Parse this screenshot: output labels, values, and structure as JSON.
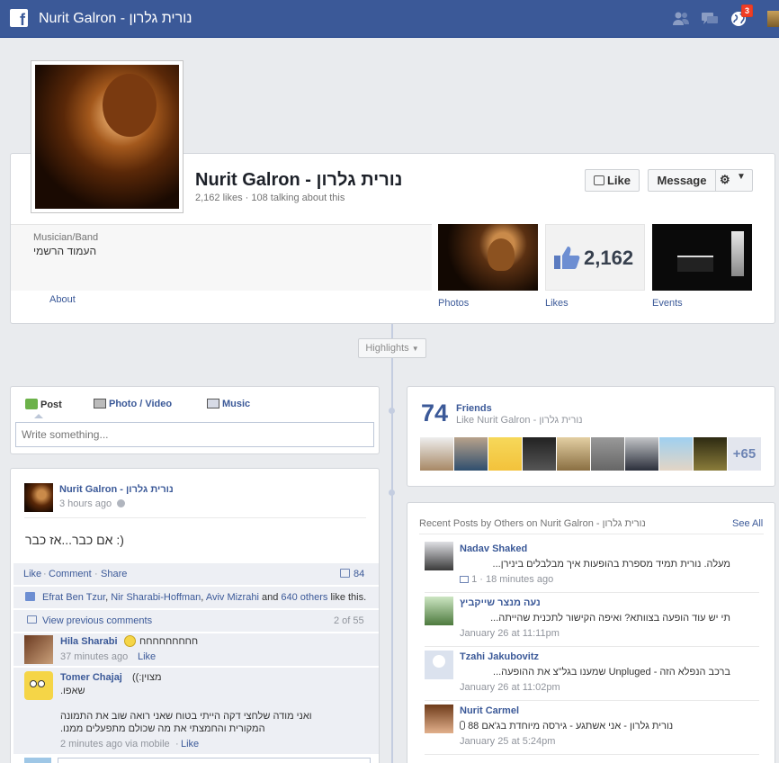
{
  "topbar": {
    "title": "Nurit Galron - נורית גלרון",
    "notifications_count": "3",
    "logo": "f"
  },
  "page": {
    "name": "Nurit Galron - נורית גלרון",
    "stats": "2,162 likes · 108 talking about this",
    "category": "Musician/Band",
    "description": "העמוד הרשמי",
    "about_label": "About",
    "like_button": "Like",
    "message_button": "Message"
  },
  "apps": {
    "photos_label": "Photos",
    "likes_label": "Likes",
    "likes_count": "2,162",
    "events_label": "Events"
  },
  "timeline": {
    "highlights_label": "Highlights"
  },
  "composer": {
    "tabs": [
      "Post",
      "Photo / Video",
      "Music"
    ],
    "placeholder": "Write something..."
  },
  "post": {
    "author": "Nurit Galron - נורית גלרון",
    "time": "3 hours ago",
    "text": "אם כבר...אז כבר :)",
    "actions": [
      "Like",
      "Comment",
      "Share"
    ],
    "share_count": "84",
    "likes_line_names": [
      "Efrat Ben Tzur",
      "Nir Sharabi-Hoffman",
      "Aviv Mizrahi"
    ],
    "likes_line_others": "640 others",
    "likes_line_and": "and",
    "likes_line_suffix": "like this.",
    "view_previous": "View previous comments",
    "comments_count": "2 of 55",
    "comments": [
      {
        "author": "Hila Sharabi",
        "text": "חחחחחחחחח",
        "time": "37 minutes ago",
        "like": "Like"
      },
      {
        "author": "Tomer Chajaj",
        "text_line1": "מצוין:))",
        "text_line2": "שאפו.",
        "text_line3": "ואני מודה שלחצי דקה הייתי בטוח שאני רואה שוב את התמונה",
        "text_line4": "המקורית והחמצתי את מה שכולם מתפעלים ממנו.",
        "time": "2 minutes ago via mobile",
        "like": "Like"
      }
    ]
  },
  "friends": {
    "count": "74",
    "label": "Friends",
    "sub": "Like Nurit Galron - נורית גלרון",
    "more": "+65"
  },
  "recent": {
    "header": "Recent Posts by Others on Nurit Galron - נורית גלרון",
    "see_all": "See All",
    "items": [
      {
        "author": "Nadav Shaked",
        "text": "מעלה. נורית תמיד מספרת בהופעות איך מבלבלים בינירן...",
        "meta_count": "1",
        "time": "18 minutes ago"
      },
      {
        "author": "נעה מנצר שייקביץ",
        "text": "תי יש עוד הופעה בצוותא? ואיפה הקישור לתכנית שהייתה...",
        "time": "January 26 at 11:11pm"
      },
      {
        "author": "Tzahi Jakubovitz",
        "text": "ברכב הנפלא הזה - Unpluged שמענו בגל\"צ את ההופעה...",
        "time": "January 26 at 11:02pm"
      },
      {
        "author": "Nurit Carmel",
        "text": "נורית גלרון - אני אשתגע - גירסה מיוחדת בג'אם 88",
        "time": "January 25 at 5:24pm"
      }
    ]
  },
  "colors": {
    "brand": "#3b5998",
    "background": "#e9ebee",
    "badge": "#f03d25"
  }
}
